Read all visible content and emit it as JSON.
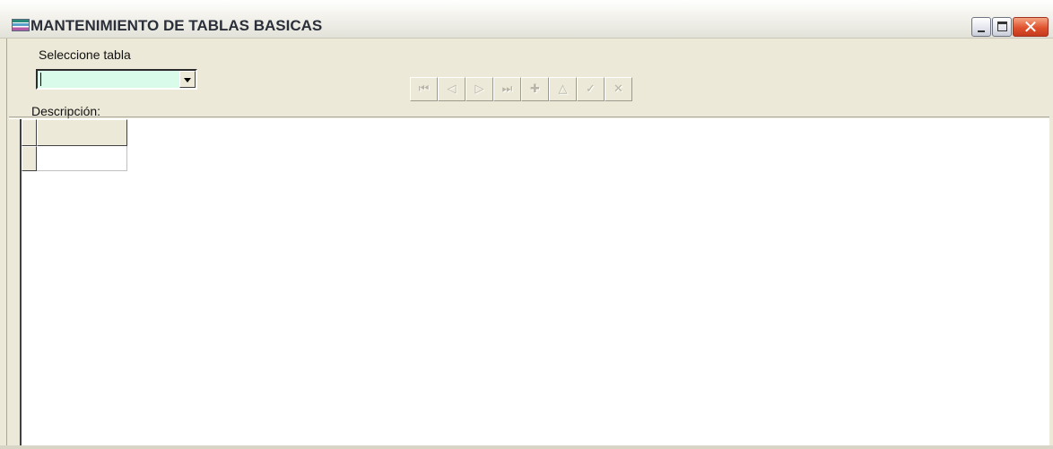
{
  "window": {
    "title": "MANTENIMIENTO DE TABLAS BASICAS",
    "app_icon": "app-logo-icon",
    "buttons": {
      "minimize": "minimize-icon",
      "maximize": "maximize-icon",
      "close_glyph": "✕"
    }
  },
  "form": {
    "table_select": {
      "label": "Seleccione tabla",
      "value": "",
      "background_color": "#d9fbe9"
    },
    "description_label": "Descripción:"
  },
  "navigator": {
    "buttons": [
      {
        "name": "first",
        "glyph": "⏮",
        "icon": "first-record-icon",
        "enabled": false
      },
      {
        "name": "prior",
        "glyph": "◁",
        "icon": "prior-record-icon",
        "enabled": false
      },
      {
        "name": "next",
        "glyph": "▷",
        "icon": "next-record-icon",
        "enabled": false
      },
      {
        "name": "last",
        "glyph": "⏭",
        "icon": "last-record-icon",
        "enabled": false
      },
      {
        "name": "insert",
        "glyph": "✚",
        "icon": "insert-record-icon",
        "enabled": false
      },
      {
        "name": "edit",
        "glyph": "△",
        "icon": "edit-record-icon",
        "enabled": false
      },
      {
        "name": "post",
        "glyph": "✓",
        "icon": "post-record-icon",
        "enabled": false
      },
      {
        "name": "cancel",
        "glyph": "✕",
        "icon": "cancel-record-icon",
        "enabled": false
      }
    ]
  },
  "grid": {
    "columns": [
      ""
    ],
    "rows": [
      [
        ""
      ]
    ]
  }
}
